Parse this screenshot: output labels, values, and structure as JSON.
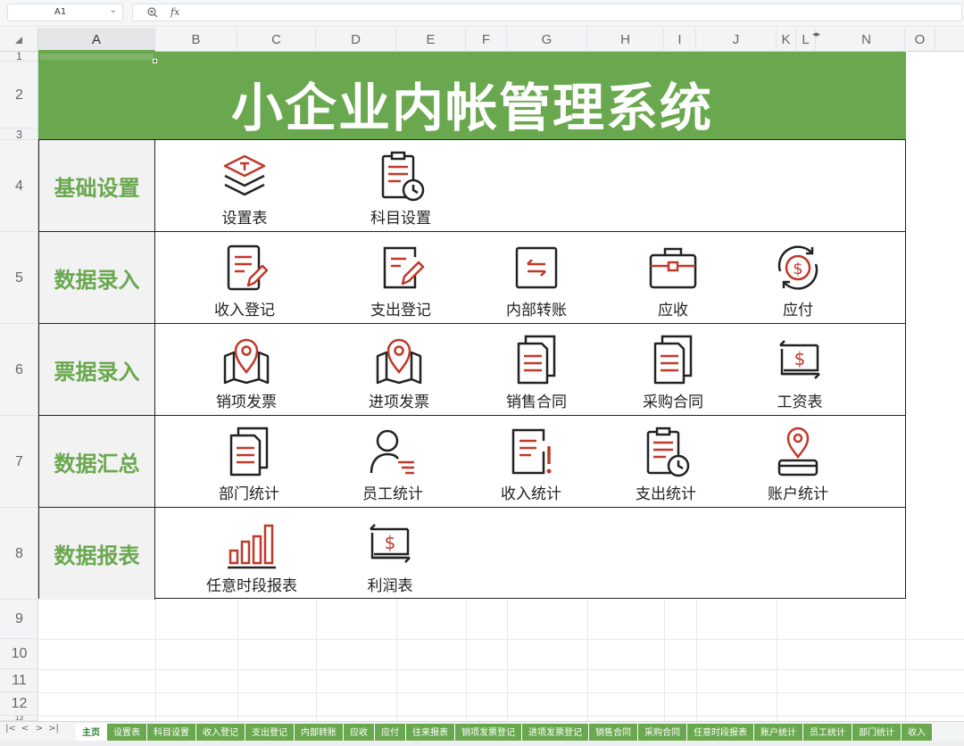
{
  "name_box": {
    "value": "A1"
  },
  "formula_bar": {
    "fx_label": "fx"
  },
  "columns": [
    "A",
    "B",
    "C",
    "D",
    "E",
    "F",
    "G",
    "H",
    "I",
    "J",
    "K",
    "L",
    "N",
    "O"
  ],
  "rows": [
    "1",
    "2",
    "3",
    "4",
    "5",
    "6",
    "7",
    "8",
    "9",
    "10",
    "11",
    "12",
    "13"
  ],
  "banner": {
    "title": "小企业内帐管理系统",
    "background": "#6aa84f"
  },
  "colors": {
    "accent_green": "#6aa84f",
    "icon_red": "#c0392b",
    "icon_dark": "#222222"
  },
  "menu": {
    "basic": {
      "label": "基础设置",
      "items": [
        {
          "label": "设置表",
          "icon": "layers-icon"
        },
        {
          "label": "科目设置",
          "icon": "clipboard-clock-icon"
        }
      ]
    },
    "entry": {
      "label": "数据录入",
      "items": [
        {
          "label": "收入登记",
          "icon": "document-edit-icon"
        },
        {
          "label": "支出登记",
          "icon": "document-pen-icon"
        },
        {
          "label": "内部转账",
          "icon": "transfer-icon"
        },
        {
          "label": "应收",
          "icon": "briefcase-icon"
        },
        {
          "label": "应付",
          "icon": "dollar-refresh-icon"
        }
      ]
    },
    "invoice": {
      "label": "票据录入",
      "items": [
        {
          "label": "销项发票",
          "icon": "map-pin-icon"
        },
        {
          "label": "进项发票",
          "icon": "map-pin-icon"
        },
        {
          "label": "销售合同",
          "icon": "documents-icon"
        },
        {
          "label": "采购合同",
          "icon": "documents-icon"
        },
        {
          "label": "工资表",
          "icon": "dollar-bill-icon"
        }
      ]
    },
    "summary": {
      "label": "数据汇总",
      "items": [
        {
          "label": "部门统计",
          "icon": "documents-icon"
        },
        {
          "label": "员工统计",
          "icon": "user-list-icon"
        },
        {
          "label": "收入统计",
          "icon": "document-alert-icon"
        },
        {
          "label": "支出统计",
          "icon": "clipboard-clock-icon"
        },
        {
          "label": "账户统计",
          "icon": "location-wallet-icon"
        }
      ]
    },
    "report": {
      "label": "数据报表",
      "items": [
        {
          "label": "任意时段报表",
          "icon": "bar-chart-icon"
        },
        {
          "label": "利润表",
          "icon": "dollar-bill-icon"
        }
      ]
    }
  },
  "sheet_tabs": [
    "主页",
    "设置表",
    "科目设置",
    "收入登记",
    "支出登记",
    "内部转账",
    "应收",
    "应付",
    "往来报表",
    "销项发票登记",
    "进项发票登记",
    "销售合同",
    "采购合同",
    "任意时段报表",
    "账户统计",
    "员工统计",
    "部门统计",
    "收入"
  ],
  "active_tab": "主页"
}
